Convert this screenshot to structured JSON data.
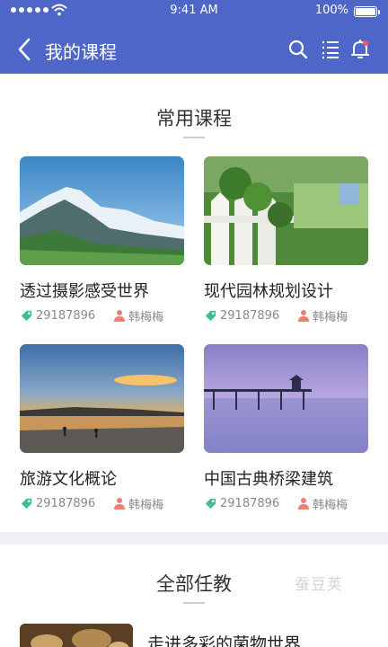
{
  "status_bar": {
    "time": "9:41 AM",
    "battery": "100%"
  },
  "nav": {
    "title": "我的课程",
    "icons": [
      "back-icon",
      "search-icon",
      "list-icon",
      "bell-icon"
    ]
  },
  "common_section": {
    "title": "常用课程"
  },
  "courses": [
    {
      "title": "透过摄影感受世界",
      "code": "29187896",
      "teacher": "韩梅梅",
      "image": "mountain-photo"
    },
    {
      "title": "现代园林规划设计",
      "code": "29187896",
      "teacher": "韩梅梅",
      "image": "garden-photo"
    },
    {
      "title": "旅游文化概论",
      "code": "29187896",
      "teacher": "韩梅梅",
      "image": "sunset-beach-photo"
    },
    {
      "title": "中国古典桥梁建筑",
      "code": "29187896",
      "teacher": "韩梅梅",
      "image": "pier-photo"
    }
  ],
  "all_section": {
    "title": "全部任教",
    "watermark": "蚕豆荚"
  },
  "list": [
    {
      "title": "走进多彩的菌物世界"
    }
  ],
  "colors": {
    "nav_bg": "#4f66c9",
    "tag_icon": "#3dbd9a",
    "user_icon": "#ee7f73"
  }
}
